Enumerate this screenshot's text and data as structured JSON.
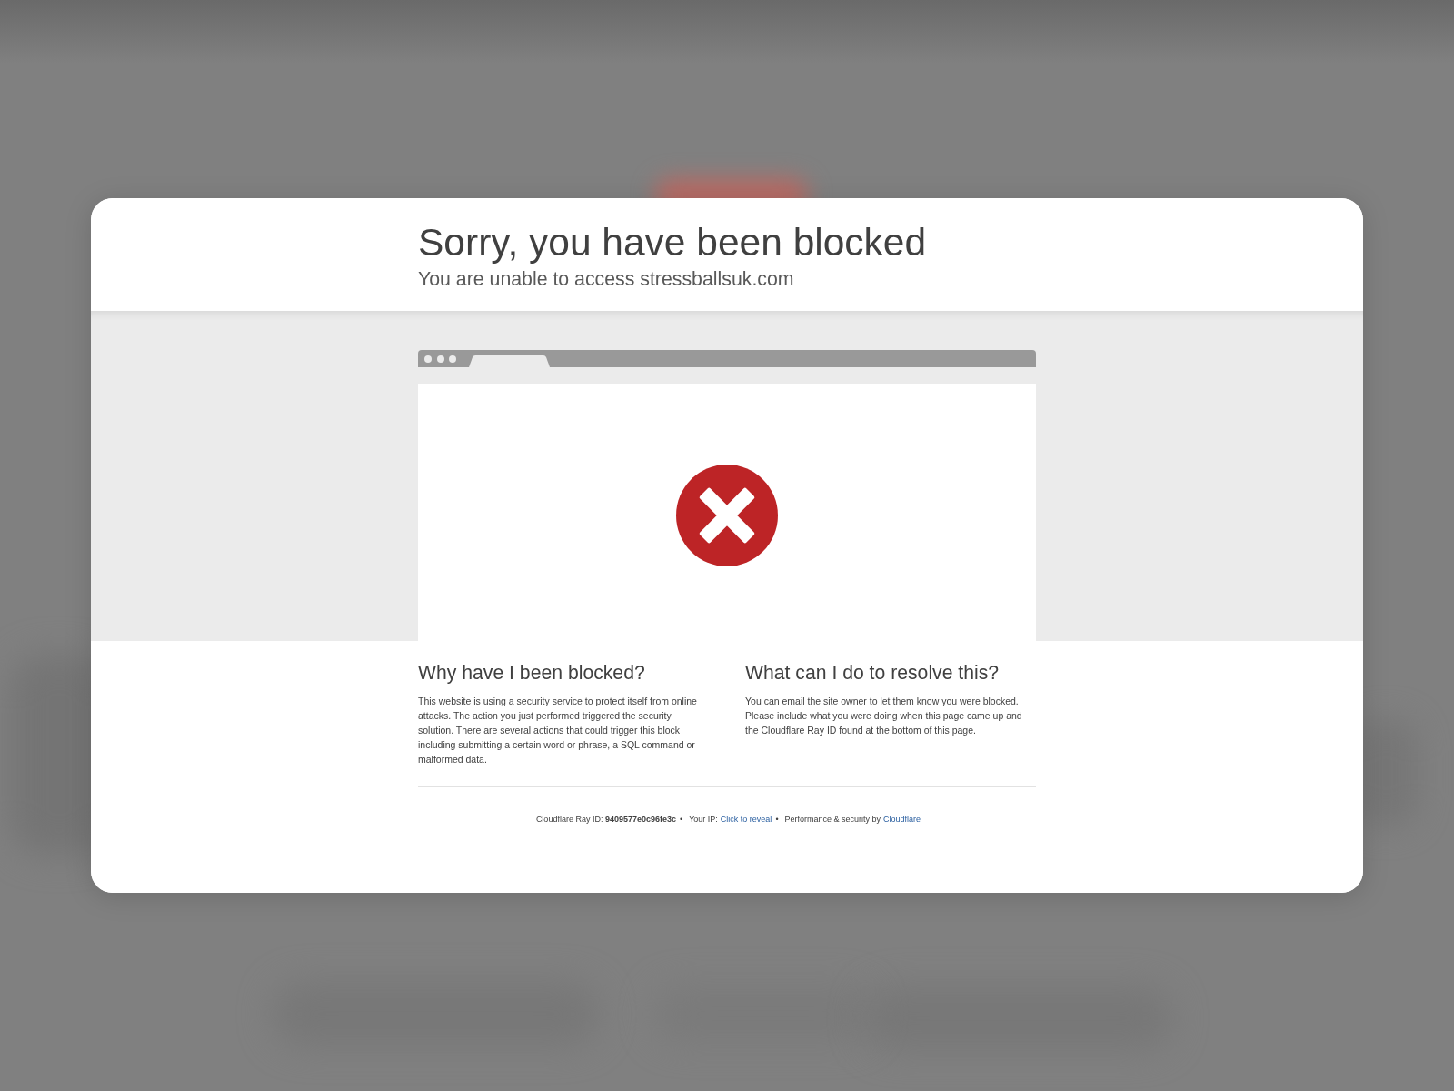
{
  "heading": {
    "title": "Sorry, you have been blocked",
    "subtitle": "You are unable to access stressballsuk.com"
  },
  "sections": [
    {
      "title": "Why have I been blocked?",
      "text": "This website is using a security service to protect itself from online attacks. The action you just performed triggered the security solution. There are several actions that could trigger this block including submitting a certain word or phrase, a SQL command or malformed data."
    },
    {
      "title": "What can I do to resolve this?",
      "text": "You can email the site owner to let them know you were blocked. Please include what you were doing when this page came up and the Cloudflare Ray ID found at the bottom of this page."
    }
  ],
  "footer": [
    {
      "kind": "text",
      "text": "Cloudflare Ray ID: **9409577e0c96fe3c**"
    },
    {
      "kind": "separator",
      "text": "•"
    },
    {
      "kind": "text",
      "text": "Your IP:"
    },
    {
      "kind": "link",
      "text": "Click to reveal"
    },
    {
      "kind": "separator",
      "text": "•"
    },
    {
      "kind": "text",
      "text": "Performance & security by"
    },
    {
      "kind": "link",
      "text": "Cloudflare"
    }
  ]
}
